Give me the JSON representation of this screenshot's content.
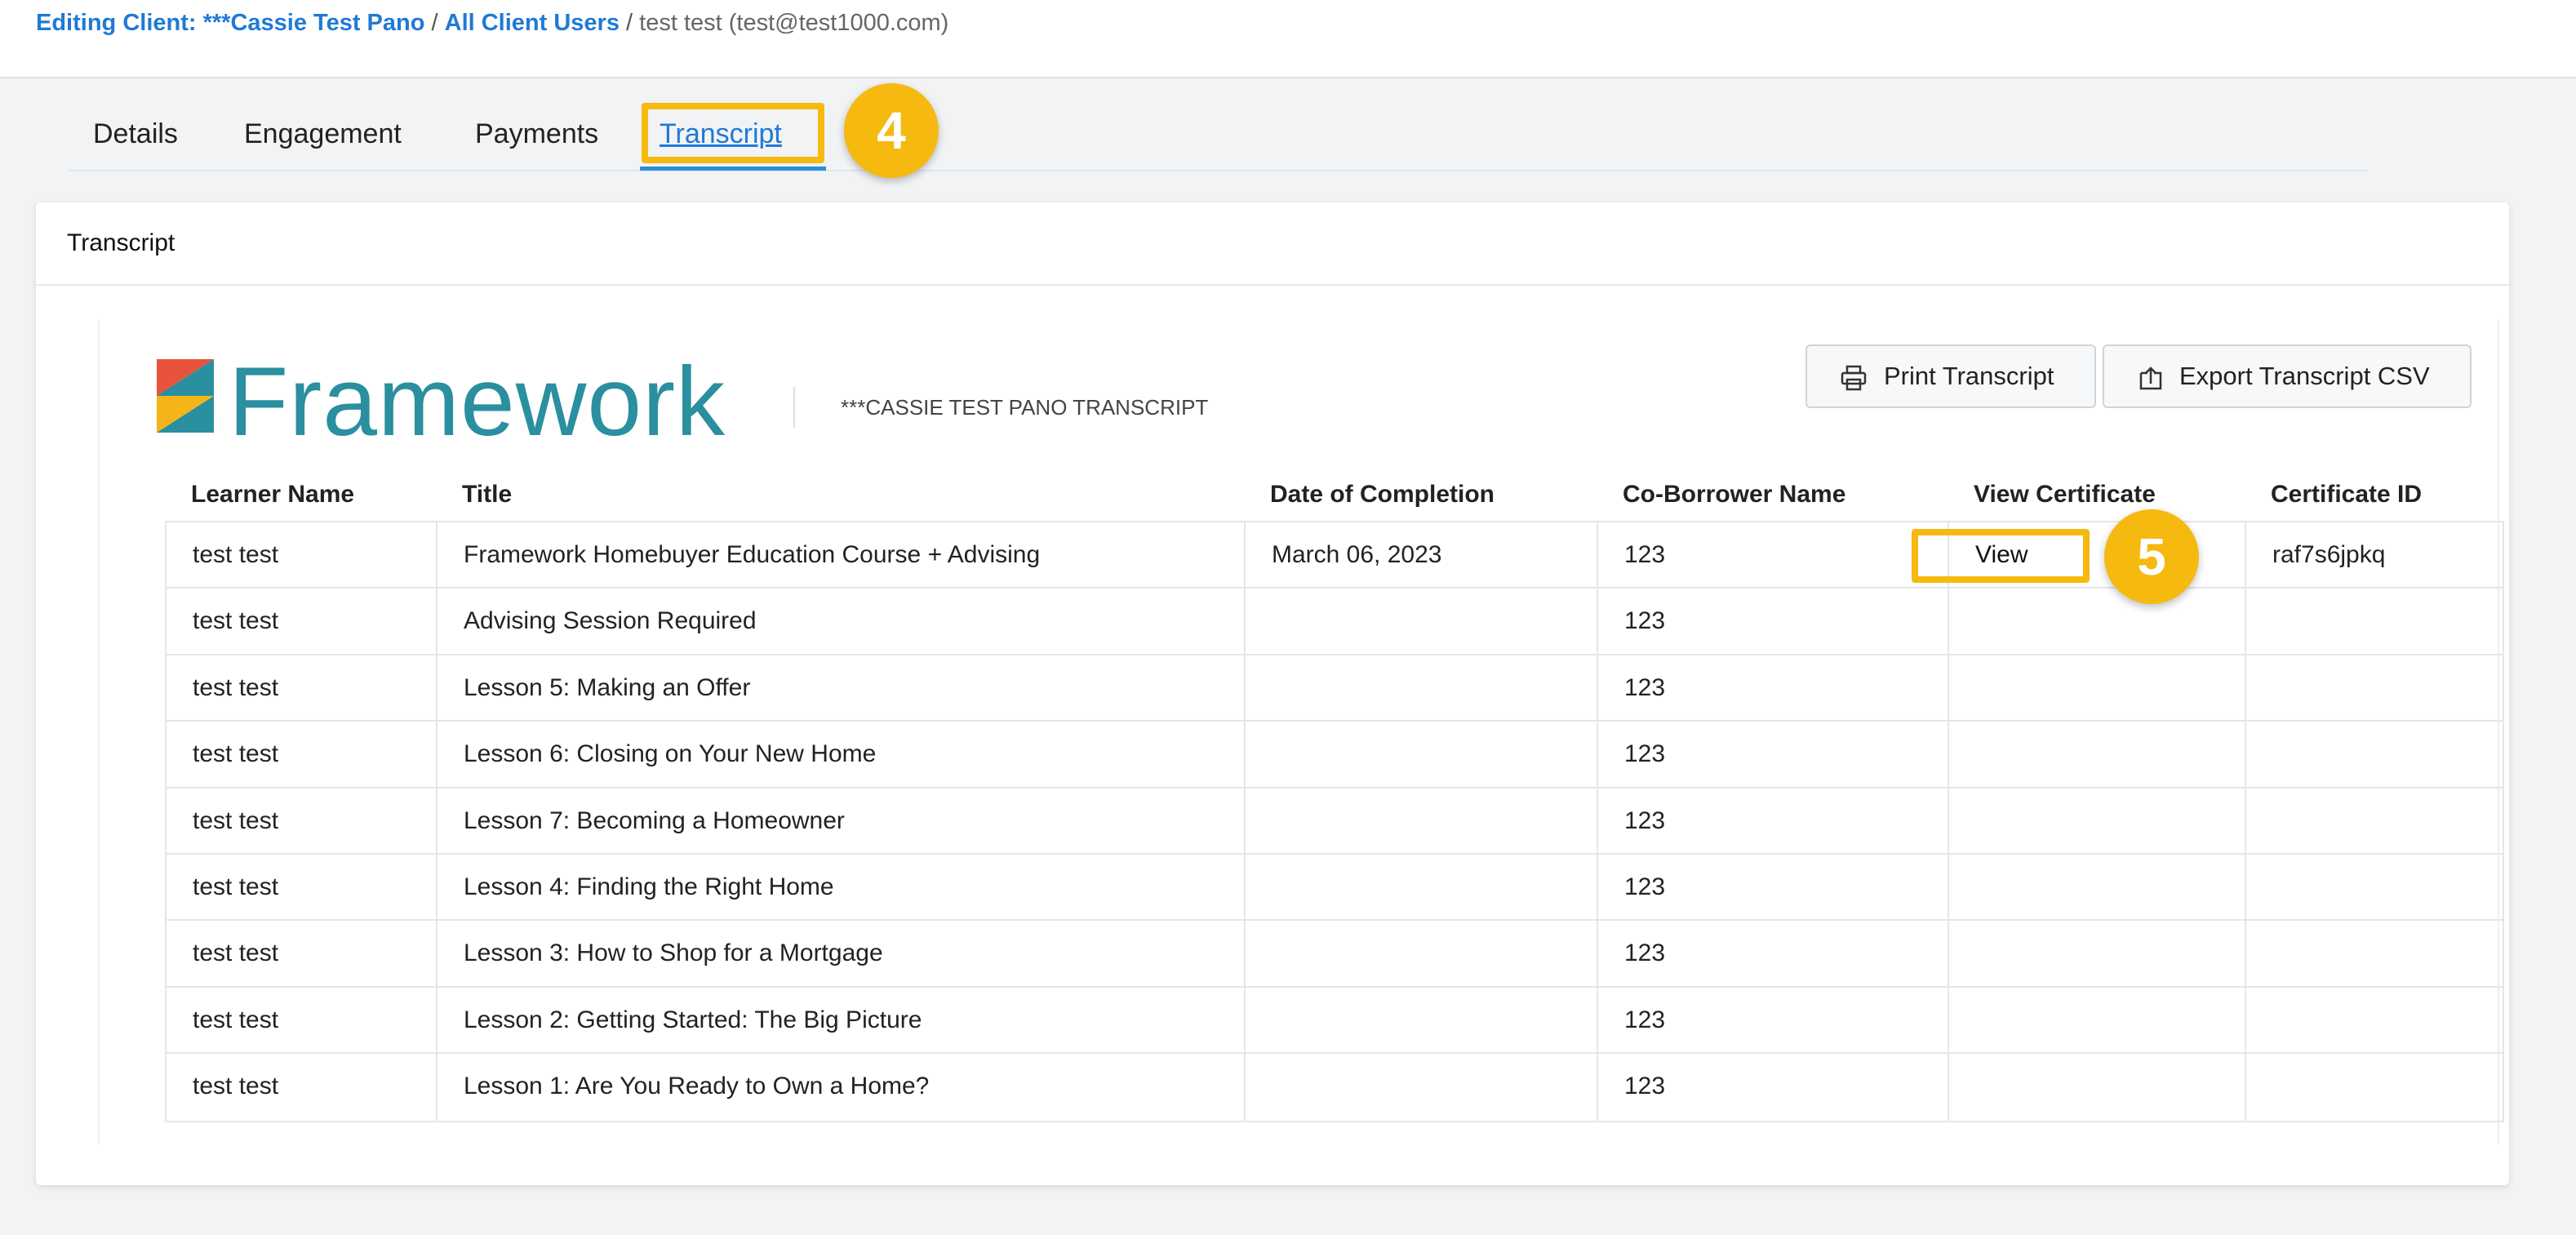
{
  "breadcrumb": {
    "client_link": "Editing Client: ***Cassie Test Pano",
    "sep1": " / ",
    "users_link": "All Client Users",
    "sep2": " / ",
    "current": "test test (test@test1000.com)"
  },
  "tabs": [
    {
      "label": "Details"
    },
    {
      "label": "Engagement"
    },
    {
      "label": "Payments"
    },
    {
      "label": "Transcript",
      "active": true
    }
  ],
  "callouts": {
    "tab": "4",
    "view": "5"
  },
  "card": {
    "title": "Transcript"
  },
  "brand": {
    "logo_text": "Framework",
    "transcript_label": "***CASSIE TEST PANO TRANSCRIPT",
    "logo_color": "#2a8f9f"
  },
  "buttons": {
    "print": "Print Transcript",
    "export": "Export Transcript CSV"
  },
  "table": {
    "headers": [
      "Learner Name",
      "Title",
      "Date of Completion",
      "Co-Borrower Name",
      "View Certificate",
      "Certificate ID"
    ],
    "rows": [
      {
        "learner": "test test",
        "title": "Framework Homebuyer Education Course + Advising",
        "date": "March 06, 2023",
        "coborrower": "123",
        "view": "View",
        "cert_id": "raf7s6jpkq"
      },
      {
        "learner": "test test",
        "title": "Advising Session Required",
        "date": "",
        "coborrower": "123",
        "view": "",
        "cert_id": ""
      },
      {
        "learner": "test test",
        "title": "Lesson 5: Making an Offer",
        "date": "",
        "coborrower": "123",
        "view": "",
        "cert_id": ""
      },
      {
        "learner": "test test",
        "title": "Lesson 6: Closing on Your New Home",
        "date": "",
        "coborrower": "123",
        "view": "",
        "cert_id": ""
      },
      {
        "learner": "test test",
        "title": "Lesson 7: Becoming a Homeowner",
        "date": "",
        "coborrower": "123",
        "view": "",
        "cert_id": ""
      },
      {
        "learner": "test test",
        "title": "Lesson 4: Finding the Right Home",
        "date": "",
        "coborrower": "123",
        "view": "",
        "cert_id": ""
      },
      {
        "learner": "test test",
        "title": "Lesson 3: How to Shop for a Mortgage",
        "date": "",
        "coborrower": "123",
        "view": "",
        "cert_id": ""
      },
      {
        "learner": "test test",
        "title": "Lesson 2: Getting Started: The Big Picture",
        "date": "",
        "coborrower": "123",
        "view": "",
        "cert_id": ""
      },
      {
        "learner": "test test",
        "title": "Lesson 1: Are You Ready to Own a Home?",
        "date": "",
        "coborrower": "123",
        "view": "",
        "cert_id": ""
      }
    ]
  },
  "colors": {
    "link": "#1f7ad6",
    "highlight": "#f6b90f",
    "tab_underline": "#2a8fd8"
  }
}
